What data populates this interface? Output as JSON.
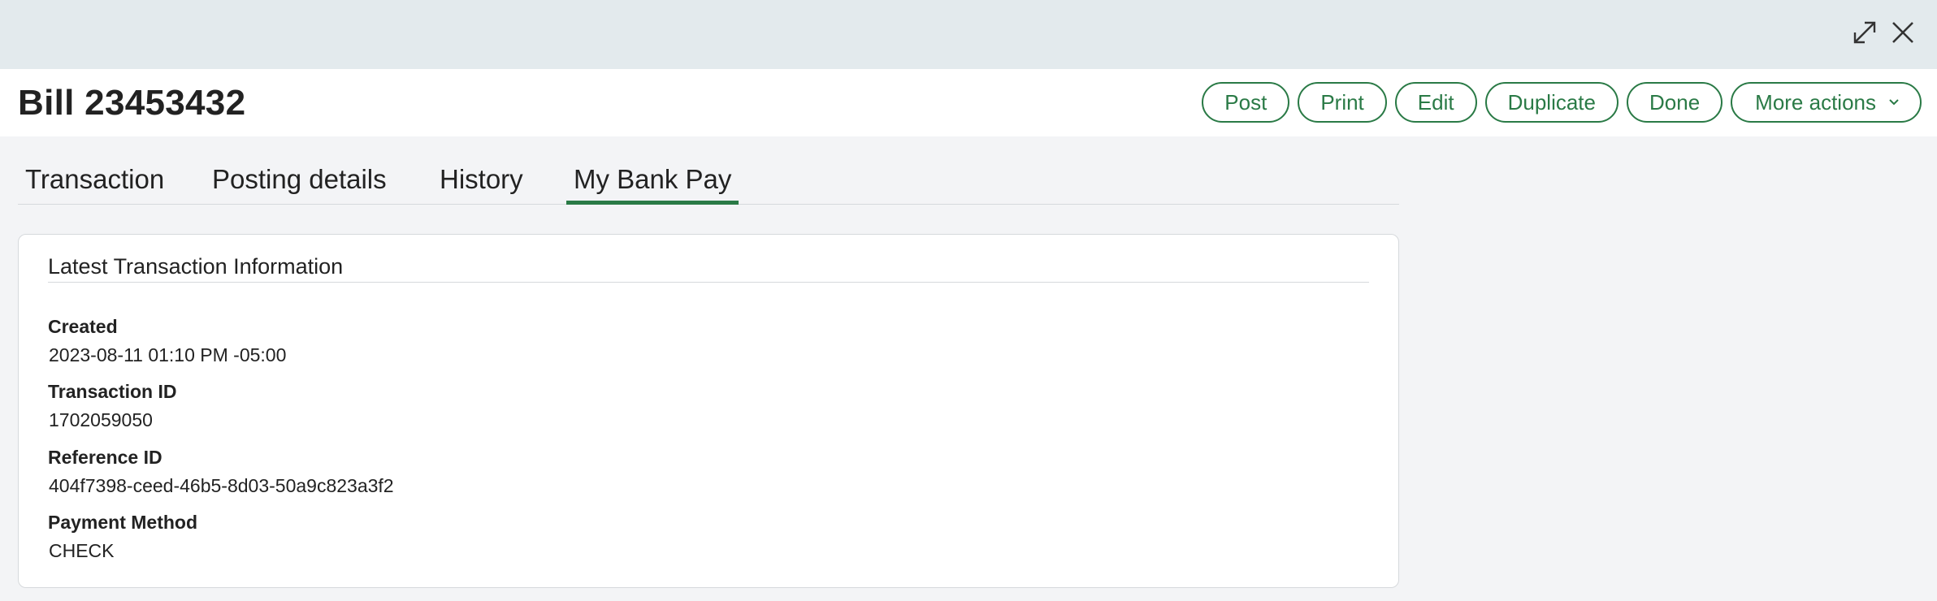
{
  "window": {
    "expand_icon": "expand-arrows-icon",
    "close_icon": "close-x-icon"
  },
  "header": {
    "title": "Bill 23453432"
  },
  "actions": {
    "post": "Post",
    "print": "Print",
    "edit": "Edit",
    "duplicate": "Duplicate",
    "done": "Done",
    "more": "More actions"
  },
  "tabs": [
    {
      "label": "Transaction"
    },
    {
      "label": "Posting details"
    },
    {
      "label": "History"
    },
    {
      "label": "My Bank Pay",
      "active": true
    }
  ],
  "card": {
    "title": "Latest Transaction Information",
    "fields": [
      {
        "label": "Created",
        "value": "2023-08-11 01:10 PM -05:00"
      },
      {
        "label": "Transaction ID",
        "value": "1702059050"
      },
      {
        "label": "Reference ID",
        "value": "404f7398-ceed-46b5-8d03-50a9c823a3f2"
      },
      {
        "label": "Payment Method",
        "value": "CHECK"
      }
    ]
  },
  "colors": {
    "accent": "#2a7a46",
    "topbar": "#e3eaed",
    "background": "#f3f4f6"
  }
}
